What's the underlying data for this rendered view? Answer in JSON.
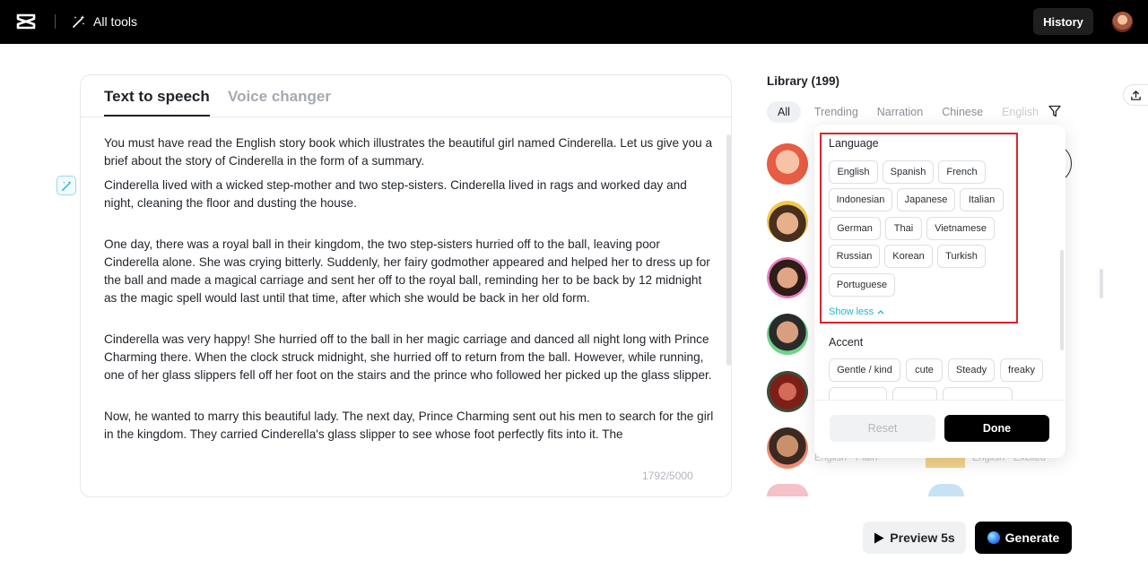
{
  "topbar": {
    "all_tools_label": "All tools",
    "history_label": "History"
  },
  "editor": {
    "tabs": [
      {
        "label": "Text to speech",
        "active": true
      },
      {
        "label": "Voice changer",
        "active": false
      }
    ],
    "paragraphs": [
      "You must have read the English story book which illustrates the beautiful girl named Cinderella. Let us give you a brief about the story of Cinderella in the form of a summary.",
      "Cinderella lived with a wicked step-mother and two step-sisters. Cinderella lived in rags and worked day and night, cleaning the floor and dusting the house.",
      "One day, there was a royal ball in their kingdom, the two step-sisters hurried off to the ball, leaving poor Cinderella alone. She was crying bitterly. Suddenly, her fairy godmother appeared and helped her to dress up for the ball and made a magical carriage and sent her off to the royal ball, reminding her to be back by 12 midnight as the magic spell would last until that time, after which she would be back in her old form.",
      "Cinderella was very happy! She hurried off to the ball in her magic carriage and danced all night long with Prince Charming there. When the clock struck midnight, she hurried off to return from the ball. However, while running, one of her glass slippers fell off her foot on the stairs and the prince who followed her picked up the glass slipper.",
      "Now, he wanted to marry this beautiful lady. The next day, Prince Charming sent out his men to search for the girl in the kingdom. They carried Cinderella's glass slipper to see whose foot perfectly fits into it. The"
    ],
    "char_count": "1792/5000"
  },
  "library": {
    "title": "Library (199)",
    "categories": [
      "All",
      "Trending",
      "Narration",
      "Chinese",
      "English"
    ],
    "voice_subtitles": [
      "English · Plain",
      "English · Excited"
    ]
  },
  "filter": {
    "language_title": "Language",
    "languages": [
      "English",
      "Spanish",
      "French",
      "Indonesian",
      "Japanese",
      "Italian",
      "German",
      "Thai",
      "Vietnamese",
      "Russian",
      "Korean",
      "Turkish",
      "Portuguese"
    ],
    "show_less_label": "Show less",
    "accent_title": "Accent",
    "accents": [
      "Gentle / kind",
      "cute",
      "Steady",
      "freaky"
    ],
    "reset_label": "Reset",
    "done_label": "Done"
  },
  "actions": {
    "preview_label": "Preview 5s",
    "generate_label": "Generate"
  }
}
